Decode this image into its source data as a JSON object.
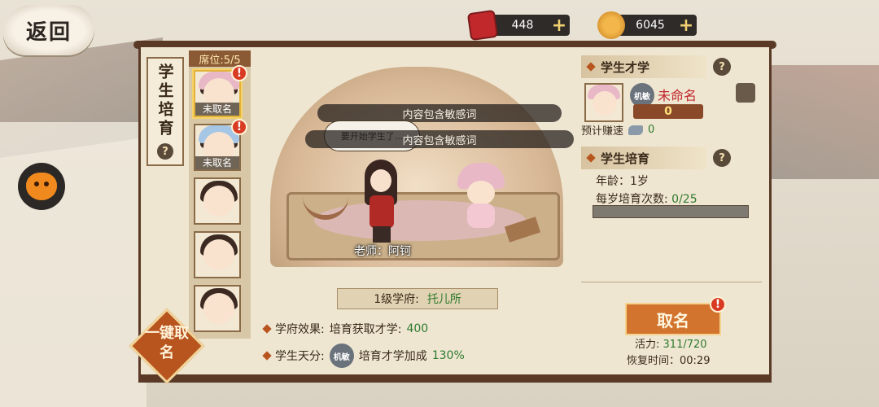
{
  "nav": {
    "back_label": "返回"
  },
  "currencies": [
    {
      "name": "ticket",
      "icon": "red-ticket-icon",
      "value": "448"
    },
    {
      "name": "gold",
      "icon": "gold-coin-icon",
      "value": "6045"
    }
  ],
  "plus_symbol": "+",
  "side_tab": {
    "title": "学生培育",
    "help": "?"
  },
  "seats": {
    "header": "席位:5/5",
    "items": [
      {
        "name": "未取名",
        "alert": "!"
      },
      {
        "name": "未取名",
        "alert": "!"
      },
      {
        "name": ""
      },
      {
        "name": ""
      },
      {
        "name": ""
      }
    ]
  },
  "one_key": {
    "label": "一键取名"
  },
  "scene": {
    "banner_1": "内容包含敏感词",
    "banner_2": "内容包含敏感词",
    "speech": "要开始学生了...",
    "teacher_label": "老师：阿钶"
  },
  "school": {
    "level": "1级学府:",
    "name": "托儿所"
  },
  "effects": [
    {
      "label": "学府效果:",
      "text": "培育获取才学:",
      "value": "400"
    },
    {
      "label": "学生天分:",
      "seal": "机敏",
      "text": "培育才学加成",
      "value": "130%"
    }
  ],
  "right": {
    "talent_title": "学生才学",
    "seal": "机敏",
    "student_name": "未命名",
    "talent_value": "0",
    "predicted_label": "预计赚速",
    "predicted_value": "0",
    "cultivate_title": "学生培育",
    "age_text": "年龄：1岁",
    "times_label": "每岁培育次数:",
    "times_value": "0/25",
    "times_progress": 0,
    "name_button": "取名",
    "name_alert": "!",
    "energy_label": "活力:",
    "energy_value": "311/720",
    "recover_text": "恢复时间：00:29",
    "help": "?"
  }
}
